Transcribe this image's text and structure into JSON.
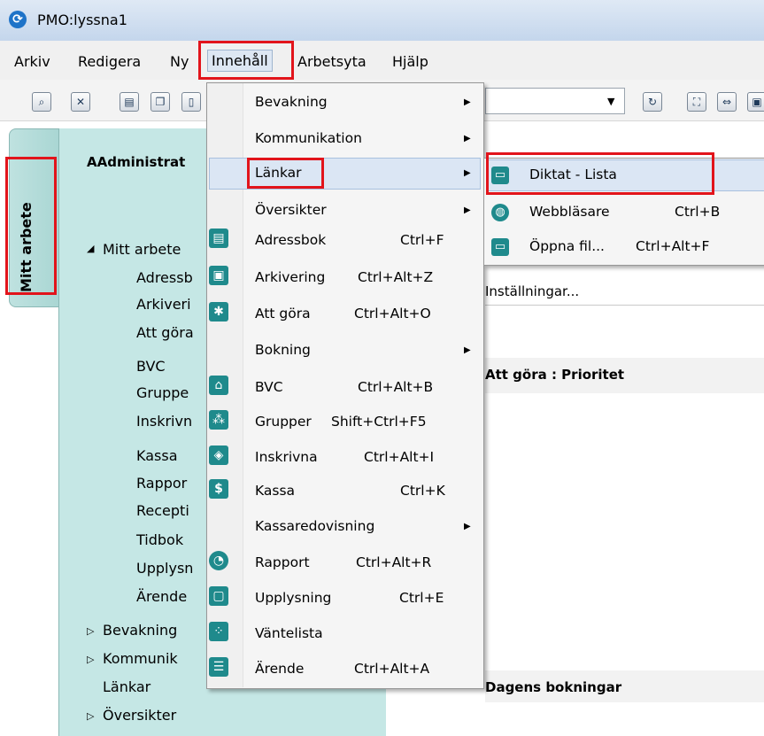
{
  "window": {
    "title": "PMO:lyssna1"
  },
  "menubar": {
    "items": [
      "Arkiv",
      "Redigera",
      "Ny",
      "Innehåll",
      "Arbetsyta",
      "Hjälp"
    ]
  },
  "left": {
    "vertical_tab": "Mitt arbete",
    "panel_title": "AAdministrat",
    "tree": {
      "root": "Mitt arbete",
      "children": [
        "Adressb",
        "Arkiveri",
        "Att göra",
        "BVC",
        "Gruppe",
        "Inskrivn",
        "Kassa",
        "Rappor",
        "Recepti",
        "Tidbok",
        "Upplysn",
        "Ärende"
      ],
      "siblings": [
        "Bevakning",
        "Kommunik",
        "Länkar",
        "Översikter"
      ]
    }
  },
  "dropdown": {
    "items": [
      {
        "label": "Bevakning",
        "shortcut": ""
      },
      {
        "label": "Kommunikation",
        "shortcut": ""
      },
      {
        "label": "Länkar",
        "shortcut": ""
      },
      {
        "label": "Översikter",
        "shortcut": ""
      },
      {
        "label": "Adressbok",
        "shortcut": "Ctrl+F"
      },
      {
        "label": "Arkivering",
        "shortcut": "Ctrl+Alt+Z"
      },
      {
        "label": "Att göra",
        "shortcut": "Ctrl+Alt+O"
      },
      {
        "label": "Bokning",
        "shortcut": ""
      },
      {
        "label": "BVC",
        "shortcut": "Ctrl+Alt+B"
      },
      {
        "label": "Grupper",
        "shortcut": "Shift+Ctrl+F5"
      },
      {
        "label": "Inskrivna",
        "shortcut": "Ctrl+Alt+I"
      },
      {
        "label": "Kassa",
        "shortcut": "Ctrl+K"
      },
      {
        "label": "Kassaredovisning",
        "shortcut": ""
      },
      {
        "label": "Rapport",
        "shortcut": "Ctrl+Alt+R"
      },
      {
        "label": "Upplysning",
        "shortcut": "Ctrl+E"
      },
      {
        "label": "Väntelista",
        "shortcut": ""
      },
      {
        "label": "Ärende",
        "shortcut": "Ctrl+Alt+A"
      }
    ]
  },
  "submenu": {
    "items": [
      {
        "label": "Diktat - Lista",
        "shortcut": ""
      },
      {
        "label": "Webbläsare",
        "shortcut": "Ctrl+B"
      },
      {
        "label": "Öppna fil...",
        "shortcut": "Ctrl+Alt+F"
      }
    ]
  },
  "right": {
    "settings_link": "Inställningar...",
    "section1": "Att göra : Prioritet",
    "section2": "Dagens bokningar"
  },
  "colors": {
    "accent": "#1f8a8c",
    "annotation": "#e2141b",
    "panel": "#c5e7e5"
  }
}
